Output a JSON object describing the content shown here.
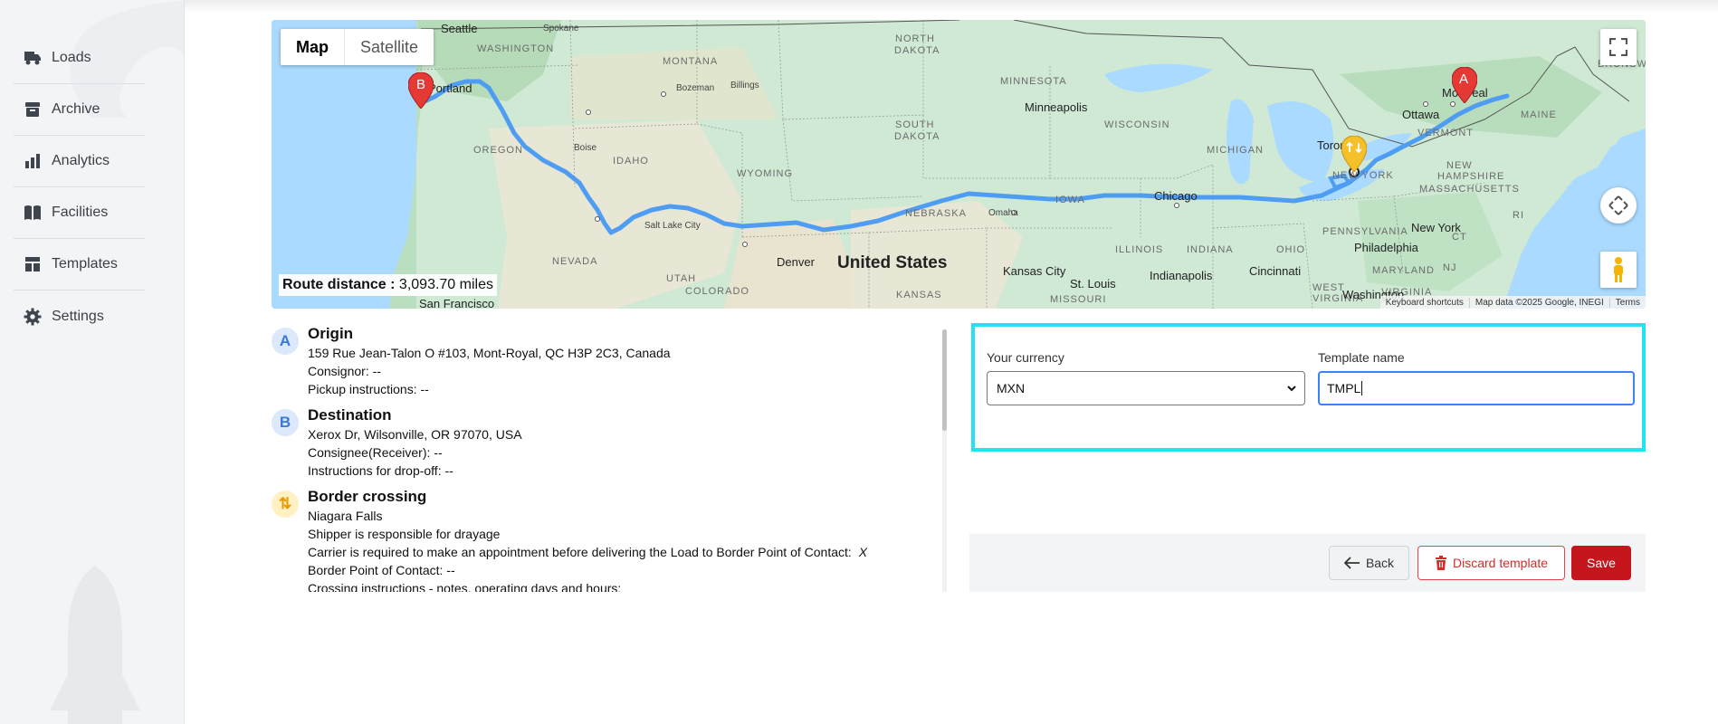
{
  "sidebar": {
    "items": [
      {
        "label": "Loads",
        "icon": "truck-icon"
      },
      {
        "label": "Archive",
        "icon": "archive-icon"
      },
      {
        "label": "Analytics",
        "icon": "bar-chart-icon"
      },
      {
        "label": "Facilities",
        "icon": "book-icon"
      },
      {
        "label": "Templates",
        "icon": "template-icon"
      },
      {
        "label": "Settings",
        "icon": "gear-icon"
      }
    ]
  },
  "map": {
    "type_buttons": {
      "map": "Map",
      "satellite": "Satellite"
    },
    "active_type": "Map",
    "route_distance_label": "Route distance :",
    "route_distance_value": "3,093.70 miles",
    "attribution": {
      "shortcuts": "Keyboard shortcuts",
      "data": "Map data ©2025 Google, INEGI",
      "terms": "Terms"
    },
    "markers": {
      "origin": "A",
      "destination": "B"
    },
    "labels": {
      "country": "United States",
      "cities": [
        "Seattle",
        "Spokane",
        "Portland",
        "Boise",
        "Bozeman",
        "Billings",
        "Salt Lake City",
        "Denver",
        "Omaha",
        "Minneapolis",
        "Chicago",
        "Toronto",
        "Ottawa",
        "Montreal",
        "New York",
        "Philadelphia",
        "Kansas City",
        "St. Louis",
        "Indianapolis",
        "Cincinnati",
        "Washington",
        "San Francisco"
      ],
      "states": [
        "WASHINGTON",
        "MONTANA",
        "NORTH DAKOTA",
        "MINNESOTA",
        "OREGON",
        "IDAHO",
        "WYOMING",
        "SOUTH DAKOTA",
        "WISCONSIN",
        "MICHIGAN",
        "NEVADA",
        "UTAH",
        "COLORADO",
        "NEBRASKA",
        "IOWA",
        "ILLINOIS",
        "INDIANA",
        "OHIO",
        "PENNSYLVANIA",
        "NEW YORK",
        "VERMONT",
        "NEW HAMPSHIRE",
        "MASSACHUSETTS",
        "MAINE",
        "KANSAS",
        "MISSOURI",
        "MARYLAND",
        "VIRGINIA",
        "BRUNSWICK",
        "RI",
        "CT",
        "NJ",
        "WEST VIRGINIA"
      ]
    },
    "colors": {
      "route": "#4f9df3",
      "water": "#aadaff",
      "land": "#c8e8d0"
    }
  },
  "stops": [
    {
      "badge": "A",
      "title": "Origin",
      "lines": [
        "159 Rue Jean-Talon O #103, Mont-Royal, QC H3P 2C3, Canada",
        "Consignor: --",
        "Pickup instructions: --"
      ]
    },
    {
      "badge": "B",
      "title": "Destination",
      "lines": [
        "Xerox Dr, Wilsonville, OR 97070, USA",
        "Consignee(Receiver): --",
        "Instructions for drop-off: --"
      ]
    },
    {
      "badge": "⇅",
      "title": "Border crossing",
      "lines": [
        "Niagara Falls",
        "Shipper is responsible for drayage",
        "Carrier is required to make an appointment before delivering the Load to Border Point of Contact:",
        "Border Point of Contact: --",
        "Crossing instructions - notes, operating days and hours:"
      ],
      "check_mark": "X"
    }
  ],
  "form": {
    "currency_label": "Your currency",
    "currency_value": "MXN",
    "template_label": "Template name",
    "template_value": "TMPL"
  },
  "actions": {
    "back": "Back",
    "discard": "Discard template",
    "save": "Save"
  }
}
